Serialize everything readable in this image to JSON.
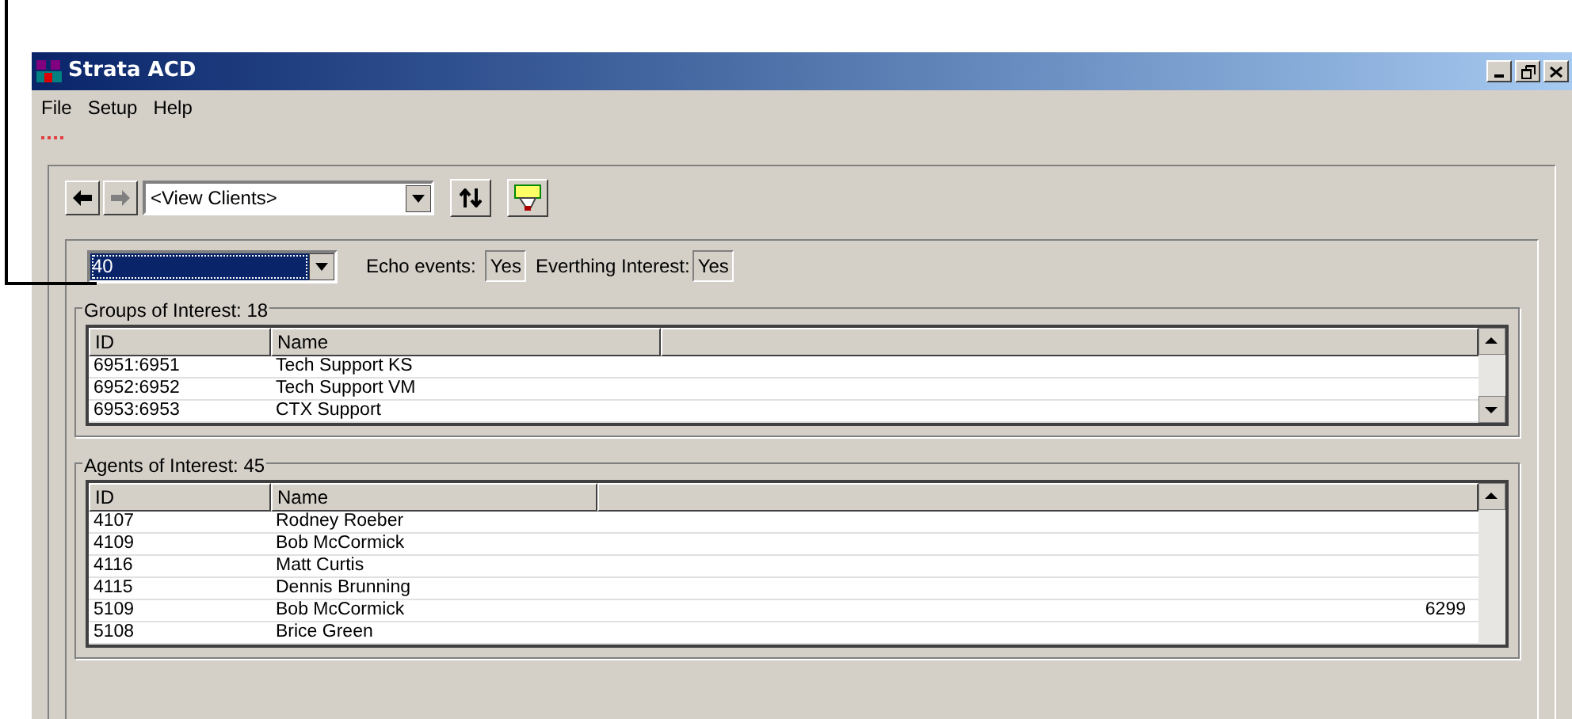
{
  "window": {
    "title": "Strata ACD"
  },
  "menu": [
    "File",
    "Setup",
    "Help"
  ],
  "toolbar": {
    "view_select": "<View Clients>"
  },
  "client": {
    "value": "40",
    "echo_label": "Echo events:",
    "echo_value": "Yes",
    "interest_label": "Everthing Interest:",
    "interest_value": "Yes"
  },
  "groups": {
    "title": "Groups of Interest: 18",
    "columns": [
      "ID",
      "Name"
    ],
    "rows": [
      [
        "6951:6951",
        "Tech Support KS",
        ""
      ],
      [
        "6952:6952",
        "Tech Support VM",
        ""
      ],
      [
        "6953:6953",
        "CTX Support",
        ""
      ]
    ]
  },
  "agents": {
    "title": "Agents of Interest: 45",
    "columns": [
      "ID",
      "Name"
    ],
    "rows": [
      [
        "4107",
        "Rodney Roeber",
        ""
      ],
      [
        "4109",
        "Bob McCormick",
        ""
      ],
      [
        "4116",
        "Matt Curtis",
        ""
      ],
      [
        "4115",
        "Dennis Brunning",
        ""
      ],
      [
        "5109",
        "Bob McCormick",
        "6299"
      ],
      [
        "5108",
        "Brice Green",
        ""
      ]
    ]
  }
}
